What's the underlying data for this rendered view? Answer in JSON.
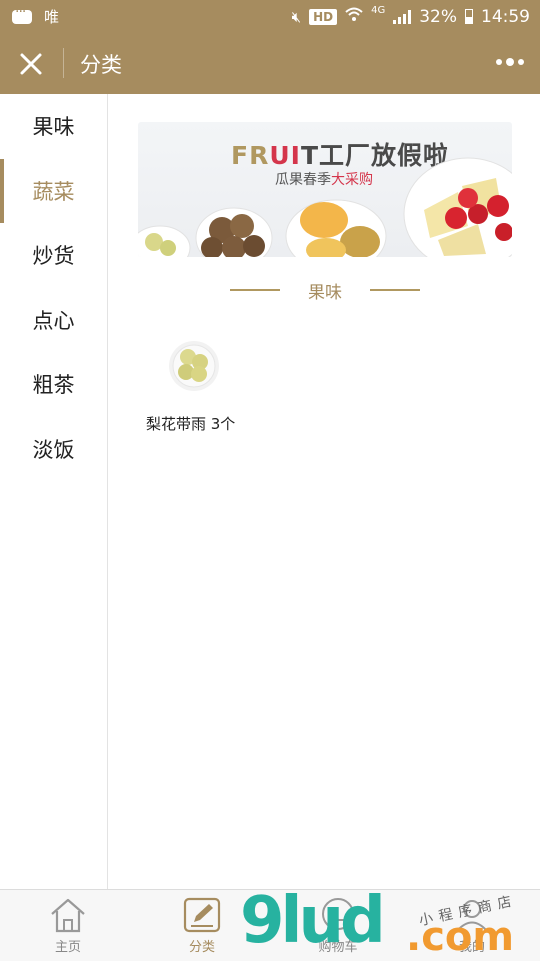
{
  "status_bar": {
    "carrier": "唯",
    "hd": "HD",
    "network": "4G",
    "battery": "32%",
    "time": "14:59"
  },
  "nav": {
    "title": "分类"
  },
  "sidebar": {
    "items": [
      {
        "label": "果味"
      },
      {
        "label": "蔬菜"
      },
      {
        "label": "炒货"
      },
      {
        "label": "点心"
      },
      {
        "label": "粗茶"
      },
      {
        "label": "淡饭"
      }
    ],
    "active_index": 1
  },
  "banner": {
    "title_a": "FR",
    "title_b": "UI",
    "title_c": "T工厂放假啦",
    "subtitle_a": "瓜果春季",
    "subtitle_b": "大采购"
  },
  "section": {
    "title": "果味"
  },
  "products": [
    {
      "name": "梨花带雨 3个"
    }
  ],
  "tabbar": {
    "items": [
      {
        "label": "主页",
        "icon": "home-icon"
      },
      {
        "label": "分类",
        "icon": "edit-icon"
      },
      {
        "label": "购物车",
        "icon": "cart-icon"
      },
      {
        "label": "我的",
        "icon": "user-icon"
      }
    ],
    "active_index": 1
  },
  "watermark": {
    "logo": "9lud",
    "domain": ".com",
    "tagline": "小程序商店"
  },
  "colors": {
    "brand": "#a68c5f",
    "text": "#222222",
    "accent_red": "#d4354b"
  }
}
